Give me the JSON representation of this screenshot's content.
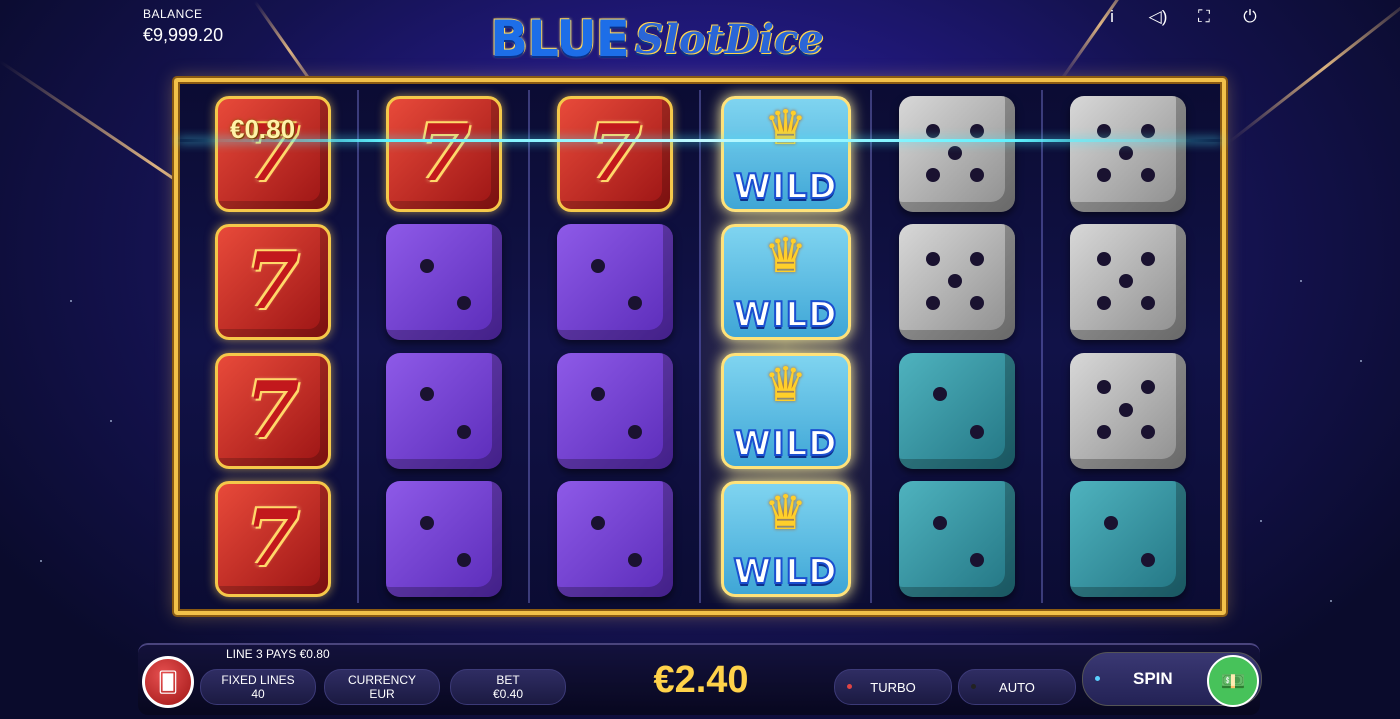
{
  "balance": {
    "label": "BALANCE",
    "value": "€9,999.20"
  },
  "logo": {
    "word1": "BLUE",
    "word2": "SlotDice"
  },
  "top_icons": [
    {
      "name": "info-icon",
      "glyph": "i"
    },
    {
      "name": "sound-icon",
      "glyph": "◁)"
    },
    {
      "name": "fullscreen-icon",
      "glyph": "⛶"
    },
    {
      "name": "power-icon",
      "glyph": "⏻"
    }
  ],
  "reels": [
    [
      "seven",
      "seven",
      "seven",
      "seven"
    ],
    [
      "seven",
      "purple-2",
      "purple-2",
      "purple-2"
    ],
    [
      "seven",
      "purple-2",
      "purple-2",
      "purple-2"
    ],
    [
      "wild",
      "wild",
      "wild",
      "wild"
    ],
    [
      "gray-5",
      "gray-5",
      "teal-2",
      "teal-2"
    ],
    [
      "gray-5",
      "gray-5",
      "gray-5",
      "teal-2"
    ]
  ],
  "win_amount": "€0.80",
  "wild_label": "WILD",
  "seven_glyph": "7",
  "bottom": {
    "win_message": "LINE 3 PAYS €0.80",
    "fixed_lines": {
      "label": "FIXED LINES",
      "value": "40"
    },
    "currency": {
      "label": "CURRENCY",
      "value": "EUR"
    },
    "bet": {
      "label": "BET",
      "value": "€0.40"
    },
    "total_bet": "€2.40",
    "turbo": "TURBO",
    "auto": "AUTO",
    "spin": "SPIN"
  },
  "colors": {
    "accent": "#ffd24a",
    "frame": "#f2c14a",
    "turbo_dot": "#e04444",
    "auto_dot": "#222222",
    "spin_dot": "#5ad0ff",
    "spin_ring": "#47c25a"
  }
}
